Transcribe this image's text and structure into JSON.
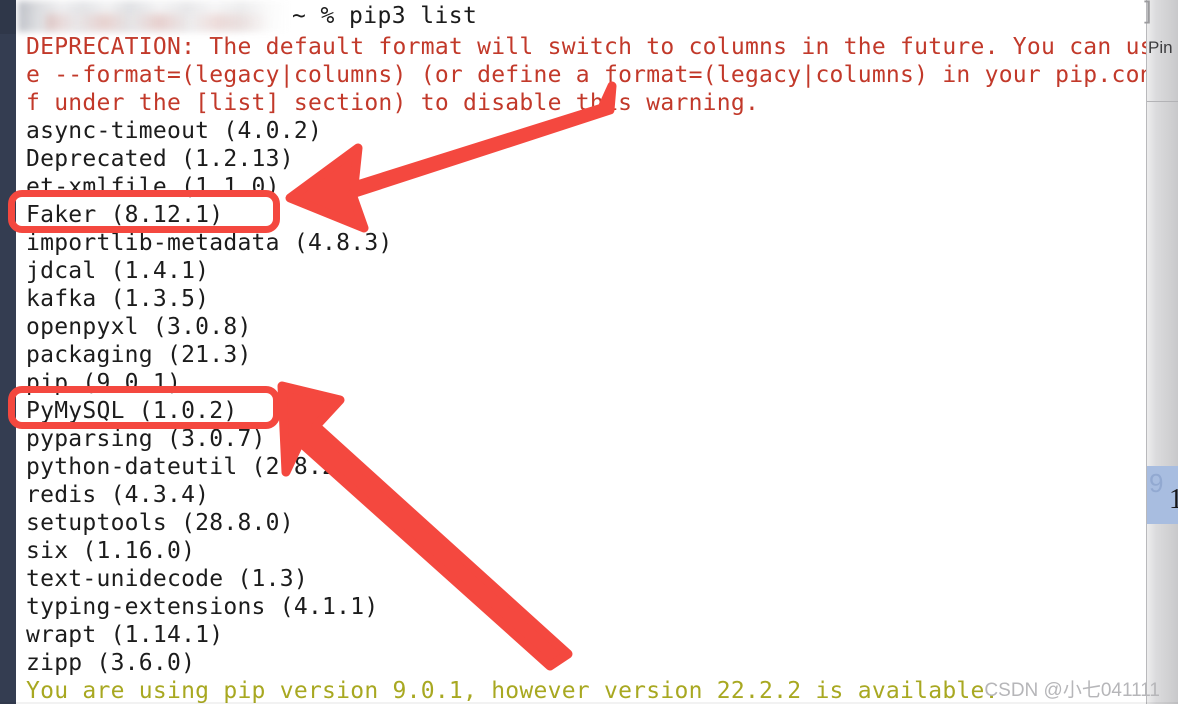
{
  "window": {
    "app": "terminal",
    "edge_color": "#343d51",
    "background": "#ffffff"
  },
  "prompt": {
    "redacted_host": "",
    "text": "~ % pip3 list",
    "command": "pip3 list"
  },
  "terminal": {
    "deprecation_lines": [
      "DEPRECATION: The default format will switch to columns in the future. You can us",
      "e --format=(legacy|columns) (or define a format=(legacy|columns) in your pip.con",
      "f under the [list] section) to disable this warning."
    ],
    "packages": [
      "async-timeout (4.0.2)",
      "Deprecated (1.2.13)",
      "et-xmlfile (1.1.0)",
      "Faker (8.12.1)",
      "importlib-metadata (4.8.3)",
      "jdcal (1.4.1)",
      "kafka (1.3.5)",
      "openpyxl (3.0.8)",
      "packaging (21.3)",
      "pip (9.0.1)",
      "PyMySQL (1.0.2)",
      "pyparsing (3.0.7)",
      "python-dateutil (2.8.2)",
      "redis (4.3.4)",
      "setuptools (28.8.0)",
      "six (1.16.0)",
      "text-unidecode (1.3)",
      "typing-extensions (4.1.1)",
      "wrapt (1.14.1)",
      "zipp (3.6.0)"
    ],
    "pip_upgrade_notice": "You are using pip version 9.0.1, however version 22.2.2 is available.",
    "colors": {
      "warning": "#c2392a",
      "package": "#1c1c1c",
      "notice": "#a8a821",
      "annotation": "#f4483f"
    }
  },
  "annotations": {
    "highlight_boxes": [
      {
        "label": "Faker (8.12.1)",
        "target": "faker"
      },
      {
        "label": "PyMySQL (1.0.2)",
        "target": "pymysql"
      }
    ],
    "arrows": [
      {
        "label": "arrow pointing to Faker",
        "direction": "down-left"
      },
      {
        "label": "arrow pointing to PyMySQL",
        "direction": "up-left"
      }
    ]
  },
  "right_panel": {
    "pin_label": "Pin",
    "stray_bracket": "]",
    "selection_ghost": "9",
    "selection_number": "1"
  },
  "watermark": {
    "text": "CSDN @小七041111"
  }
}
